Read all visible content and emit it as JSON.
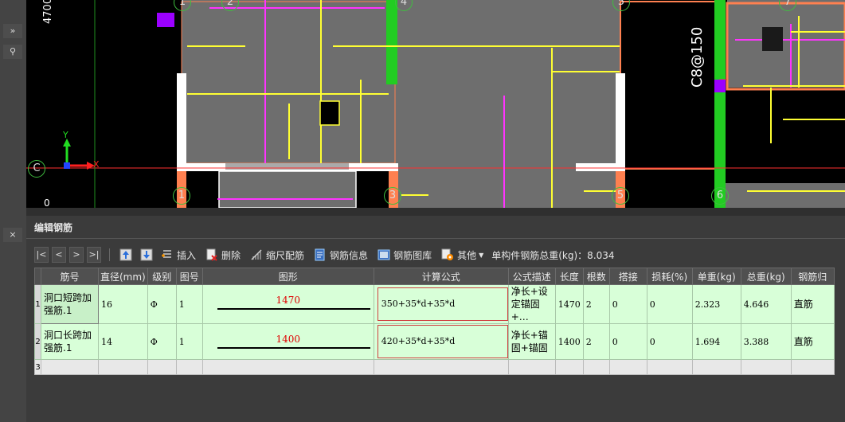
{
  "canvas": {
    "dimension_label": "4700",
    "rebar_label": "C8@150",
    "axis_y": "Y",
    "axis_x": "X",
    "axis_c": "C",
    "axis_0": "0",
    "top_axes": [
      "1",
      "2",
      "4",
      "5",
      "7"
    ],
    "bottom_axes": [
      "1",
      "3",
      "5",
      "6"
    ]
  },
  "panel": {
    "title": "编辑钢筋"
  },
  "toolbar": {
    "nav": [
      "|<",
      "<",
      ">",
      ">|"
    ],
    "insert": "插入",
    "delete": "删除",
    "scale": "缩尺配筋",
    "info": "钢筋信息",
    "library": "钢筋图库",
    "other": "其他",
    "weight_label": "单构件钢筋总重(kg)：8.034"
  },
  "grid": {
    "headers": [
      "筋号",
      "直径(mm)",
      "级别",
      "图号",
      "图形",
      "计算公式",
      "公式描述",
      "长度",
      "根数",
      "搭接",
      "损耗(%)",
      "单重(kg)",
      "总重(kg)",
      "钢筋归"
    ],
    "rows": [
      {
        "num": "1",
        "name": "洞口短跨加强筋.1",
        "diameter": "16",
        "grade": "Φ",
        "fig": "1",
        "shape_len": "1470",
        "formula": "350+35*d+35*d",
        "desc": "净长+设定锚固+…",
        "length": "1470",
        "count": "2",
        "lap": "0",
        "loss": "0",
        "unit_w": "2.323",
        "total_w": "4.646",
        "category": "直筋"
      },
      {
        "num": "2",
        "name": "洞口长跨加强筋.1",
        "diameter": "14",
        "grade": "Φ",
        "fig": "1",
        "shape_len": "1400",
        "formula": "420+35*d+35*d",
        "desc": "净长+锚固+锚固",
        "length": "1400",
        "count": "2",
        "lap": "0",
        "loss": "0",
        "unit_w": "1.694",
        "total_w": "3.388",
        "category": "直筋"
      }
    ],
    "empty_row_num": "3"
  },
  "colors": {
    "yellow": "#ffff33",
    "magenta": "#ff33ff",
    "wall_gray": "#6e6e6e",
    "green": "#22cc22",
    "orange": "#ff8050"
  }
}
